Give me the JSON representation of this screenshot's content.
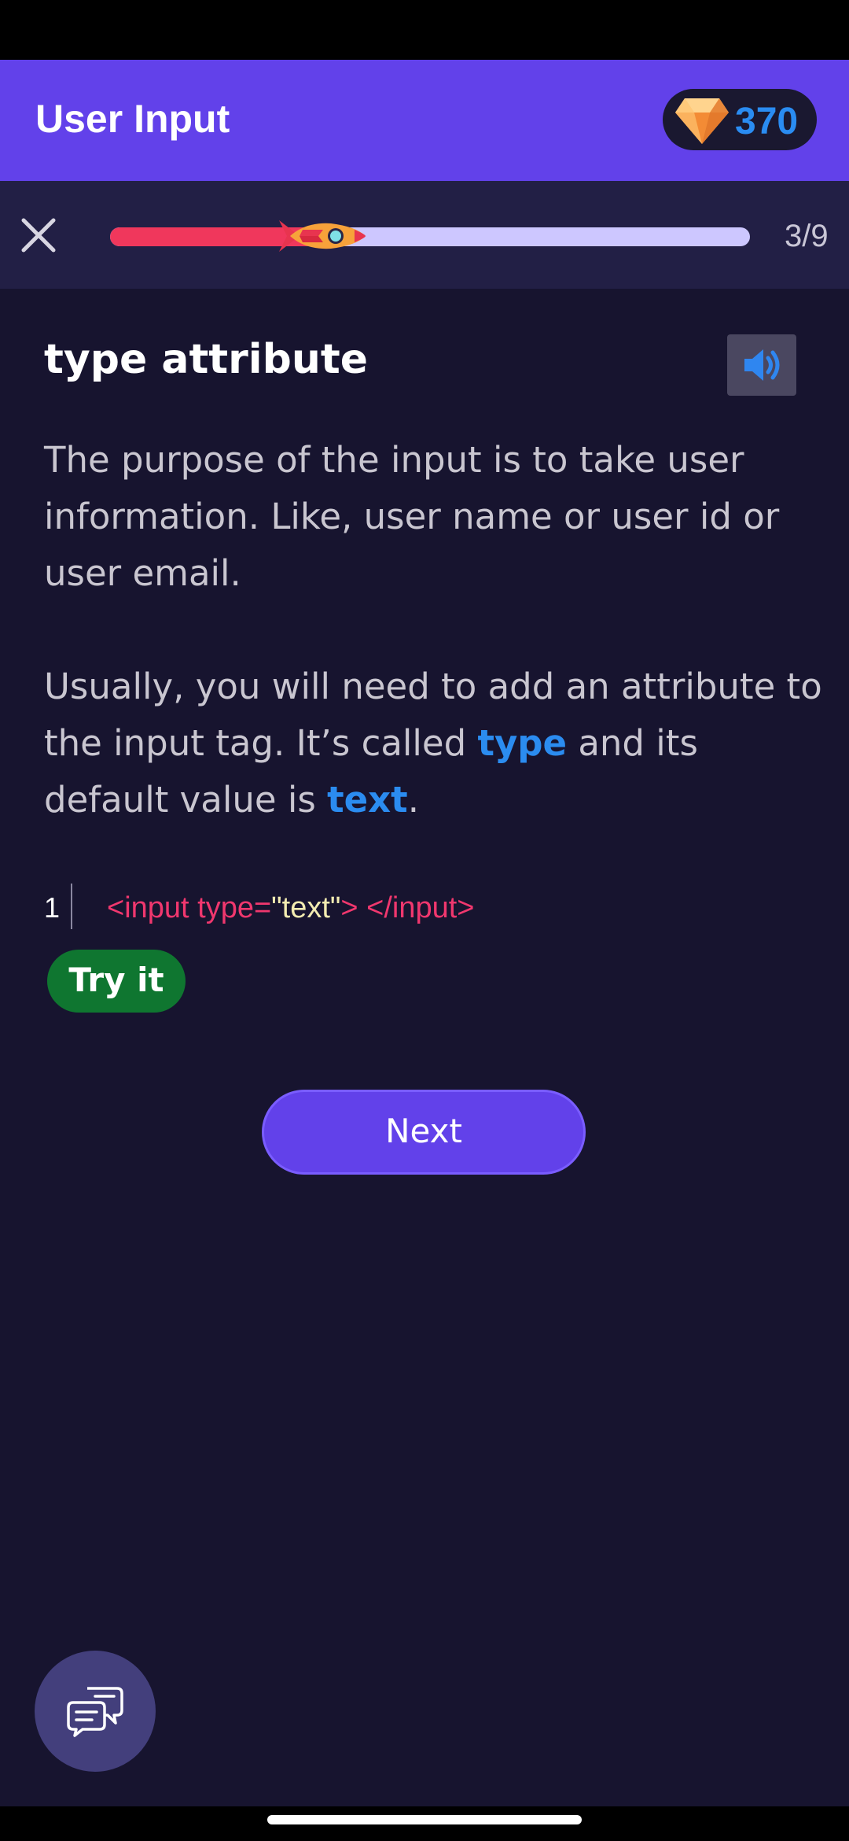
{
  "app_bar": {
    "title": "User Input",
    "gems": "370"
  },
  "progress": {
    "step_label": "3/9",
    "fraction": 0.333
  },
  "lesson": {
    "title": "type attribute",
    "paragraph1": "The purpose of the input is to take user information. Like, user name or user id or user email.",
    "paragraph2_pre": "Usually, you will need to add an attribute to the input tag. It’s called ",
    "paragraph2_kw1": "type",
    "paragraph2_mid": " and its default value is ",
    "paragraph2_kw2": "text",
    "paragraph2_end": "."
  },
  "code": {
    "line_number": "1",
    "tag_open": "<input type=",
    "string_value": "\"text\"",
    "tag_close": "> </input>"
  },
  "buttons": {
    "try_it": "Try it",
    "next": "Next"
  },
  "colors": {
    "accent": "#6241ea",
    "keyword": "#2b8cf0",
    "code_tag": "#f0376e",
    "code_string": "#f3ecb1",
    "try_button": "#0f7630",
    "background": "#17142f"
  },
  "icons": {
    "gem": "gem-icon",
    "close": "close-icon",
    "rocket": "rocket-icon",
    "audio": "speaker-icon",
    "chat": "chat-bubbles-icon"
  }
}
